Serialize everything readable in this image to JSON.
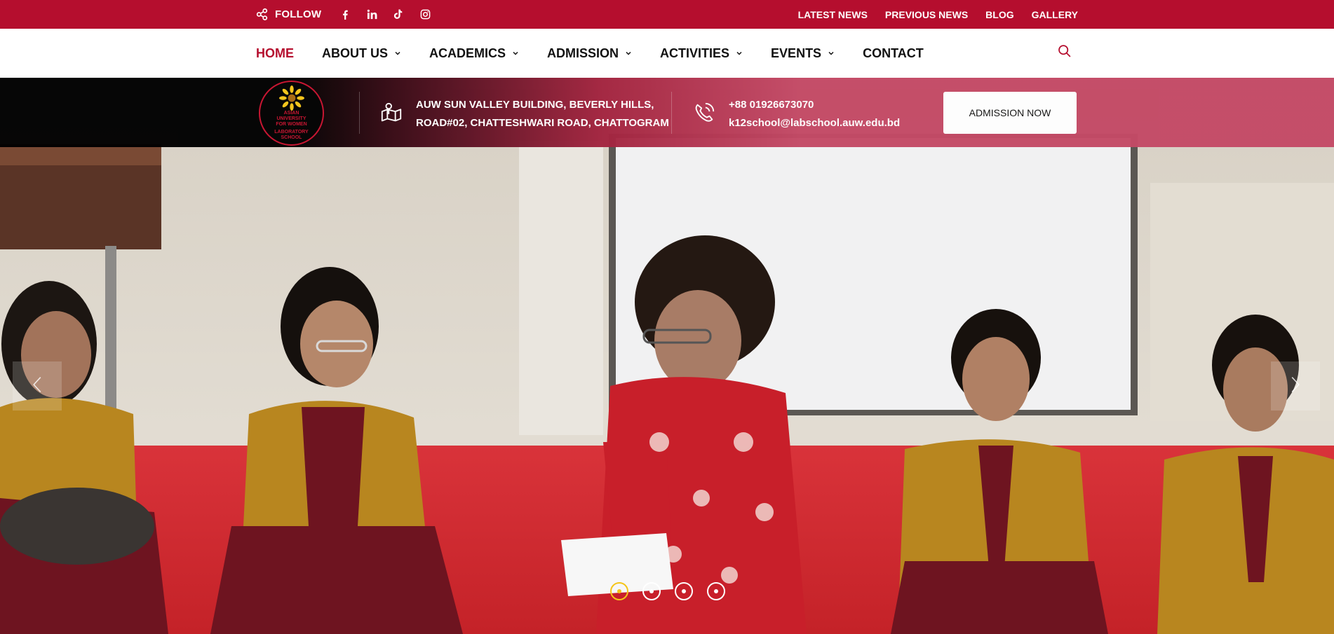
{
  "topbar": {
    "follow_label": "FOLLOW",
    "social_icons": [
      "facebook-icon",
      "linkedin-icon",
      "tiktok-icon",
      "instagram-icon"
    ],
    "links": [
      "LATEST NEWS",
      "PREVIOUS NEWS",
      "BLOG",
      "GALLERY"
    ]
  },
  "nav": {
    "items": [
      {
        "label": "HOME",
        "active": true,
        "dropdown": false
      },
      {
        "label": "ABOUT US",
        "dropdown": true
      },
      {
        "label": "ACADEMICS",
        "dropdown": true
      },
      {
        "label": "ADMISSION",
        "dropdown": true
      },
      {
        "label": "ACTIVITIES",
        "dropdown": true
      },
      {
        "label": "EVENTS",
        "dropdown": true
      },
      {
        "label": "CONTACT",
        "dropdown": false
      }
    ]
  },
  "infobar": {
    "logo_lines": [
      "ASIAN UNIVERSITY",
      "FOR WOMEN",
      "LABORATORY",
      "SCHOOL"
    ],
    "address_line1": "AUW SUN VALLEY BUILDING, BEVERLY HILLS,",
    "address_line2": "ROAD#02, CHATTESHWARI ROAD, CHATTOGRAM",
    "phone": "+88 01926673070",
    "email": "k12school@labschool.auw.edu.bd",
    "cta_label": "ADMISSION NOW"
  },
  "slider": {
    "total_slides": 4,
    "active_slide": 1
  },
  "colors": {
    "brand_red": "#b50e2e",
    "accent_yellow": "#f5c518",
    "uniform_mustard": "#b8861f",
    "uniform_maroon": "#6e1420"
  }
}
